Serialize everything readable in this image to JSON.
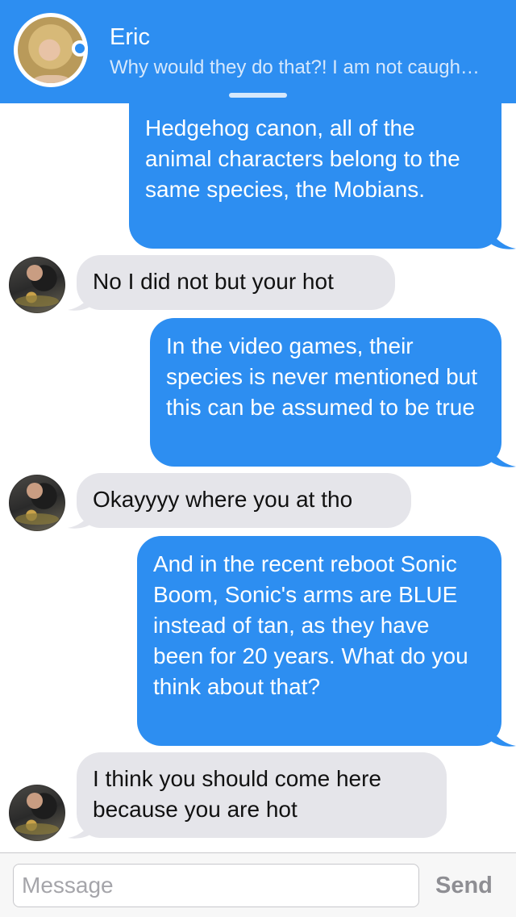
{
  "header": {
    "name": "Eric",
    "preview": "Why would they do that?! I am not caugh…"
  },
  "messages": [
    {
      "from": "me",
      "text": "Hedgehog canon, all of the animal characters belong to the same species, the Mobians."
    },
    {
      "from": "them",
      "text": "No I did not but your hot"
    },
    {
      "from": "me",
      "text": "In the video games, their species is never mentioned but this can be assumed to be true"
    },
    {
      "from": "them",
      "text": "Okayyyy where you at tho"
    },
    {
      "from": "me",
      "text": "And in the recent reboot Sonic Boom, Sonic's arms are BLUE instead of tan, as they have been for 20 years. What do you think about that?"
    },
    {
      "from": "them",
      "text": "I think you should come here because you are hot"
    }
  ],
  "composer": {
    "placeholder": "Message",
    "send_label": "Send"
  },
  "colors": {
    "accent": "#2d8ef1",
    "incoming_bubble": "#e5e5ea"
  }
}
